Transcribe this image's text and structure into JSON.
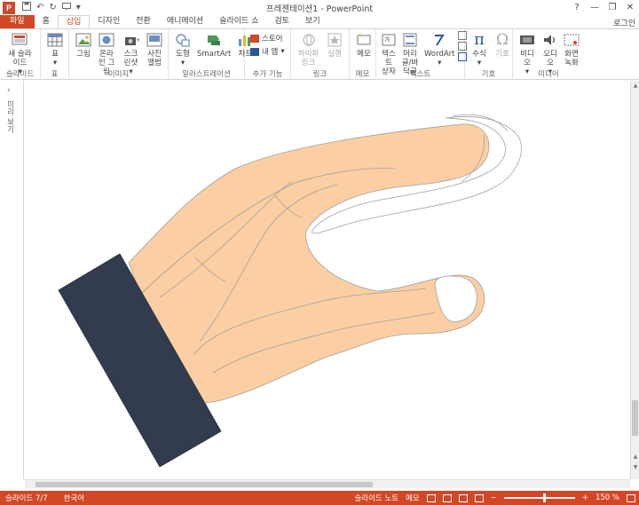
{
  "app": {
    "logo": "P",
    "title": "프레젠테이션1 - PowerPoint",
    "login": "로그인",
    "help": "?",
    "colors": {
      "accent": "#d24726",
      "skin": "#fbcfa3",
      "sleeve": "#323c4e"
    }
  },
  "qat": {
    "undo": "↶",
    "redo": "↻",
    "more": "▾"
  },
  "window": {
    "min": "—",
    "restore": "❐",
    "close": "✕"
  },
  "tabs": [
    {
      "label": "파일"
    },
    {
      "label": "홈"
    },
    {
      "label": "삽입"
    },
    {
      "label": "디자인"
    },
    {
      "label": "전환"
    },
    {
      "label": "애니메이션"
    },
    {
      "label": "슬라이드 쇼"
    },
    {
      "label": "검토"
    },
    {
      "label": "보기"
    }
  ],
  "ribbon": {
    "slides": {
      "group": "슬라이드",
      "new_slide": "새 슬라이드"
    },
    "table": {
      "group": "표",
      "table": "표"
    },
    "images": {
      "group": "이미지",
      "picture": "그림",
      "online_picture": "온라인 그림",
      "screenshot": "스크린샷",
      "album": "사진 앨범"
    },
    "illustrations": {
      "group": "일러스트레이션",
      "shapes": "도형",
      "smartart": "SmartArt",
      "chart": "차트"
    },
    "addins": {
      "group": "추가 기능",
      "store": "스토어",
      "my_addins": "내 앱"
    },
    "links": {
      "group": "링크",
      "hyperlink": "하이퍼링크",
      "action": "실행"
    },
    "comments": {
      "group": "메모",
      "comment": "메모"
    },
    "text": {
      "group": "텍스트",
      "textbox": "텍스트 상자",
      "header_footer": "머리글/바닥글",
      "wordart": "WordArt"
    },
    "symbols": {
      "group": "기호",
      "equation": "수식",
      "symbol": "기호"
    },
    "media": {
      "group": "미디어",
      "video": "비디오",
      "audio": "오디오",
      "screen_rec": "화면 녹화"
    }
  },
  "left_pane": {
    "label": "미리 보기",
    "arrow": "›"
  },
  "status": {
    "slide": "슬라이드 7/7",
    "lang": "한국어",
    "notes": "슬라이드 노트",
    "comments": "메모",
    "zoom": "150 %"
  }
}
